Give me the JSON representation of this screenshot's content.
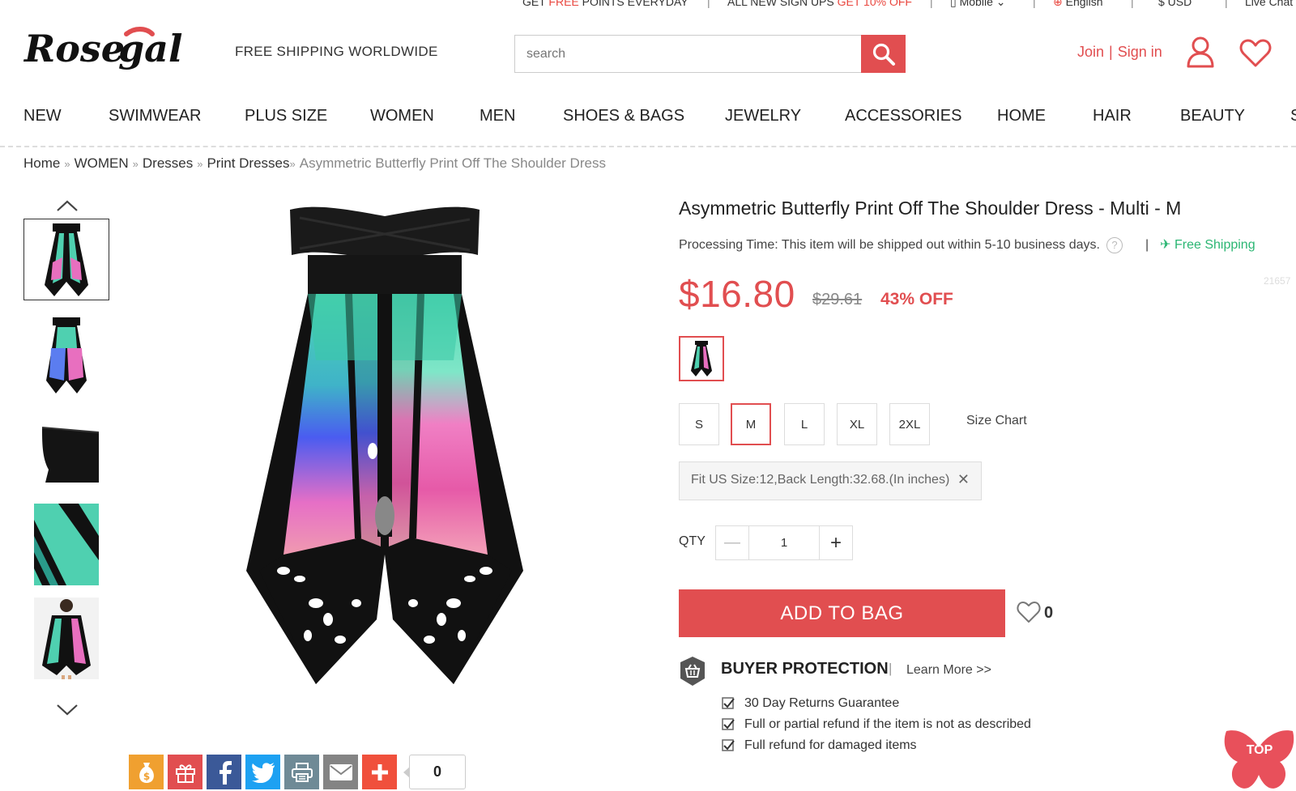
{
  "topbar": {
    "points_pre": "GET ",
    "points_free": "FREE",
    "points_post": " POINTS EVERYDAY",
    "signup_pre": "ALL NEW SIGN UPS ",
    "signup_off": "GET 10% OFF",
    "mobile": "Mobile",
    "language": "English",
    "currency": "$ USD",
    "live_chat": "Live Chat",
    "separator": "|"
  },
  "header": {
    "logo_text": "Rosegal",
    "tagline": "FREE SHIPPING WORLDWIDE",
    "search_placeholder": "search",
    "join": "Join",
    "separator": "|",
    "sign_in": "Sign in"
  },
  "nav": [
    "NEW",
    "SWIMWEAR",
    "PLUS SIZE",
    "WOMEN",
    "MEN",
    "SHOES & BAGS",
    "JEWELRY",
    "ACCESSORIES",
    "HOME",
    "HAIR",
    "BEAUTY",
    "S"
  ],
  "breadcrumb": {
    "sep": "»",
    "items": [
      "Home",
      "WOMEN",
      "Dresses",
      "Print Dresses"
    ],
    "current": "Asymmetric Butterfly Print Off The Shoulder Dress"
  },
  "product": {
    "title": "Asymmetric Butterfly Print Off The Shoulder Dress - Multi - M",
    "processing": "Processing Time: This item will be shipped out within 5-10 business days.",
    "help_glyph": "?",
    "proc_sep": "|",
    "free_shipping": "Free Shipping",
    "ghost_num": "21657",
    "price": "$16.80",
    "old_price": "$29.61",
    "discount": "43% OFF",
    "sizes": [
      "S",
      "M",
      "L",
      "XL",
      "2XL"
    ],
    "selected_size": "M",
    "size_chart": "Size Chart",
    "fit": "Fit US Size:12,Back Length:32.68.(In inches)",
    "fit_close": "✕",
    "qty_label": "QTY",
    "qty_minus": "—",
    "qty_plus": "+",
    "qty_value": "1",
    "add_to_bag": "ADD TO BAG",
    "wish_count": "0"
  },
  "buyer_protection": {
    "title": "BUYER PROTECTION",
    "sep": "|",
    "learn_more": "Learn More >>",
    "items": [
      "30 Day Returns Guarantee",
      "Full or partial refund if the item is not as described",
      "Full refund for damaged items"
    ]
  },
  "share": {
    "count": "0",
    "colors": {
      "points": "#f0a030",
      "gift": "#e14e50",
      "facebook": "#3b5998",
      "twitter": "#1da1f2",
      "print": "#6f8a96",
      "email": "#848484",
      "more": "#f0503c"
    }
  },
  "back_to_top": "TOP",
  "colors": {
    "accent": "#e14e50",
    "green": "#2bb673"
  }
}
